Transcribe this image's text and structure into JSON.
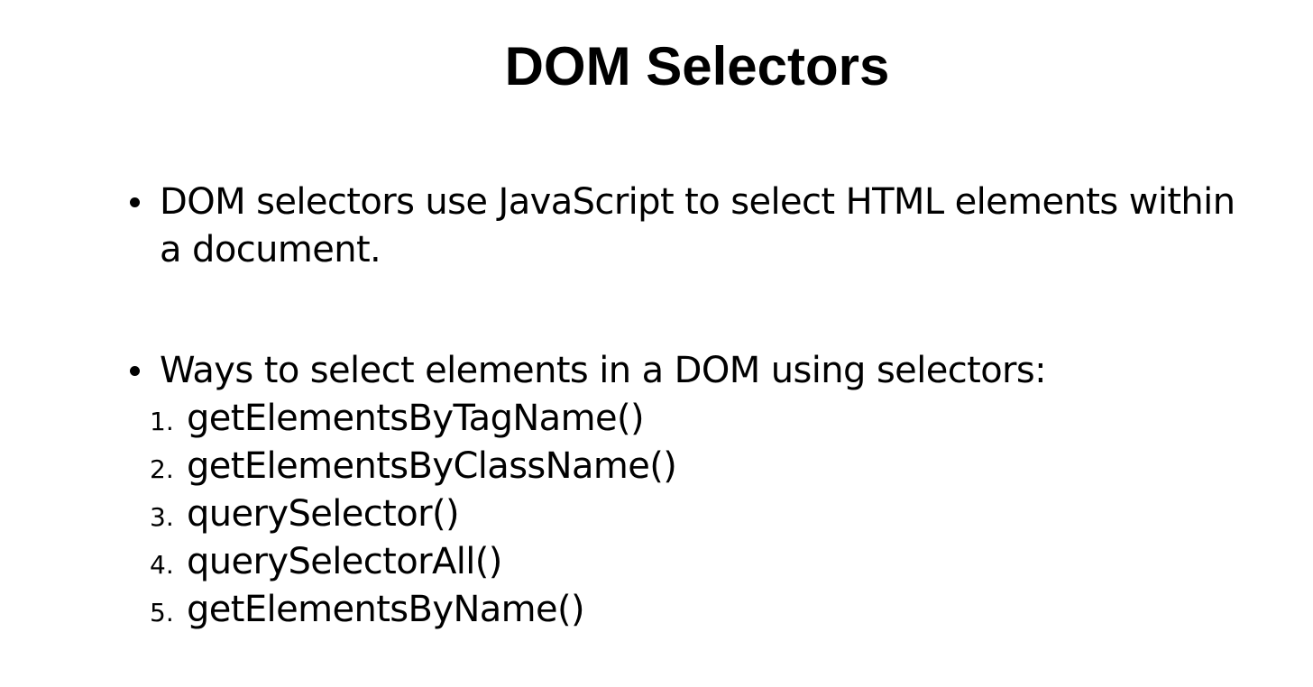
{
  "slide": {
    "title": "DOM Selectors",
    "bullets": [
      "DOM selectors use JavaScript to select HTML elements within a document.",
      "Ways to select elements in a DOM using selectors:"
    ],
    "methods": [
      {
        "number": "1.",
        "label": "getElementsByTagName()"
      },
      {
        "number": "2.",
        "label": "getElementsByClassName()"
      },
      {
        "number": "3.",
        "label": "querySelector()"
      },
      {
        "number": "4.",
        "label": "querySelectorAll()"
      },
      {
        "number": "5.",
        "label": "getElementsByName()"
      }
    ]
  }
}
